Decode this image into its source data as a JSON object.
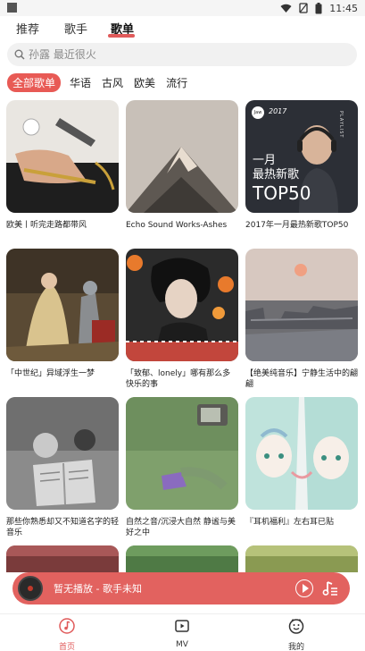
{
  "status_bar": {
    "time": "11:45",
    "icons": [
      "wifi-icon",
      "no-sim-icon",
      "battery-icon"
    ]
  },
  "tabs": [
    {
      "label": "推荐",
      "active": false
    },
    {
      "label": "歌手",
      "active": false
    },
    {
      "label": "歌单",
      "active": true
    }
  ],
  "search": {
    "placeholder": "孙露 最近很火",
    "icon": "search-icon"
  },
  "filters": [
    {
      "label": "全部歌单",
      "active": true
    },
    {
      "label": "华语",
      "active": false
    },
    {
      "label": "古风",
      "active": false
    },
    {
      "label": "欧美",
      "active": false
    },
    {
      "label": "流行",
      "active": false
    }
  ],
  "playlists": [
    {
      "title": "欧美丨听完走路都带风"
    },
    {
      "title": "Echo Sound Works-Ashes"
    },
    {
      "title": "2017年一月最热新歌TOP50",
      "cover_text": {
        "year": "2017",
        "badge": "Jaw",
        "line1": "一月",
        "line2": "最热新歌",
        "line3": "TOP50",
        "vertical": "PLAYLIST"
      }
    },
    {
      "title": "「中世纪」异域浮生一梦"
    },
    {
      "title": "「致郁、lonely」哪有那么多快乐的事"
    },
    {
      "title": "【绝美纯音乐】宁静生活中的翩翩"
    },
    {
      "title": "那些你熟悉却又不知道名字的轻音乐"
    },
    {
      "title": "自然之音/沉浸大自然 静谧与美好之中"
    },
    {
      "title": "『耳机福利』左右耳已贴"
    }
  ],
  "player": {
    "text": "暂无播放 - 歌手未知"
  },
  "bottom_nav": [
    {
      "label": "首页",
      "icon": "music-note-icon",
      "active": true
    },
    {
      "label": "MV",
      "icon": "video-icon",
      "active": false
    },
    {
      "label": "我的",
      "icon": "profile-icon",
      "active": false
    }
  ],
  "colors": {
    "accent": "#e05a5a",
    "player_bg": "#e2625f"
  }
}
